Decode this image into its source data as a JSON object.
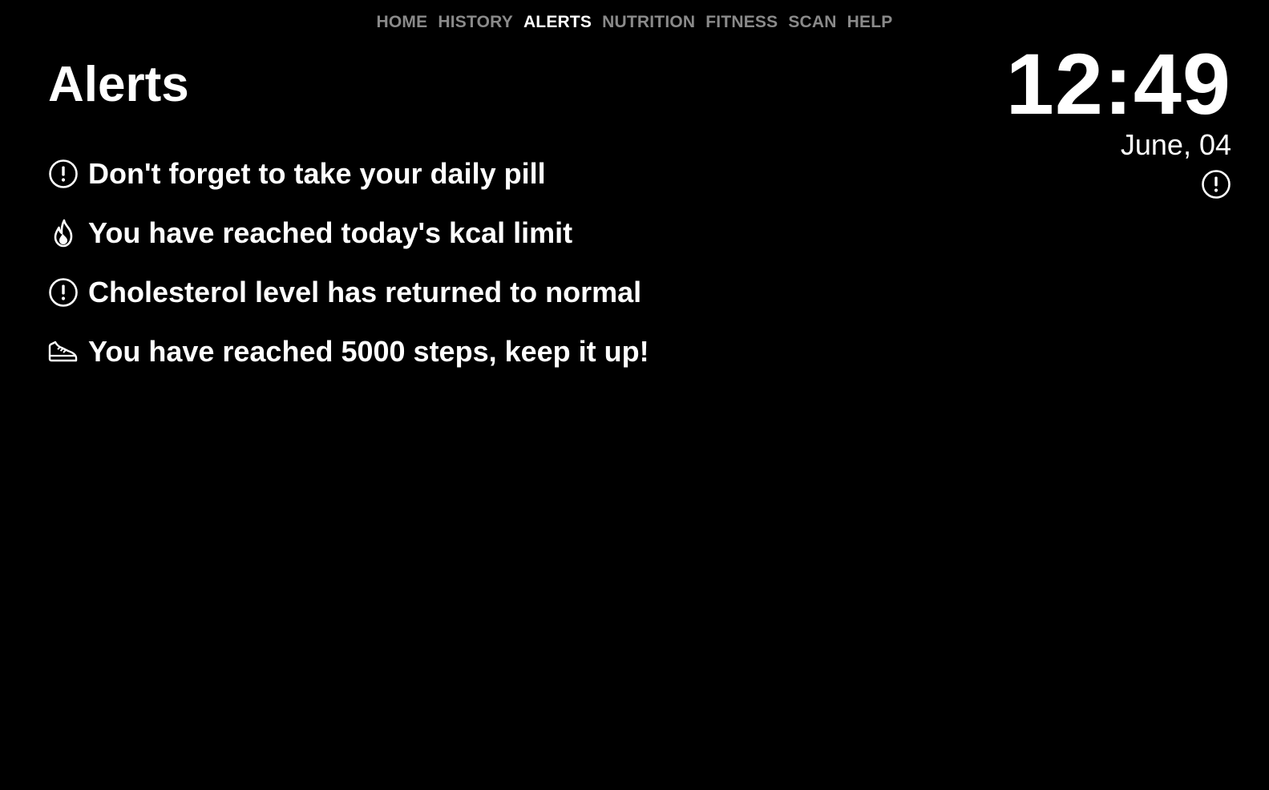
{
  "nav": {
    "items": [
      {
        "label": "HOME",
        "active": false
      },
      {
        "label": "HISTORY",
        "active": false
      },
      {
        "label": "ALERTS",
        "active": true
      },
      {
        "label": "NUTRITION",
        "active": false
      },
      {
        "label": "FITNESS",
        "active": false
      },
      {
        "label": "SCAN",
        "active": false
      },
      {
        "label": "HELP",
        "active": false
      }
    ]
  },
  "page": {
    "title": "Alerts"
  },
  "alerts": [
    {
      "icon": "exclamation-circle-icon",
      "text": "Don't forget to take your daily pill"
    },
    {
      "icon": "flame-icon",
      "text": "You have reached today's kcal limit"
    },
    {
      "icon": "exclamation-circle-icon",
      "text": "Cholesterol level has returned to normal"
    },
    {
      "icon": "sneaker-icon",
      "text": "You have reached 5000 steps, keep it up!"
    }
  ],
  "clock": {
    "time": "12:49",
    "date": "June, 04",
    "status_icon": "exclamation-circle-icon"
  },
  "colors": {
    "background": "#000000",
    "text": "#ffffff",
    "nav_inactive": "#8a8a8a"
  }
}
